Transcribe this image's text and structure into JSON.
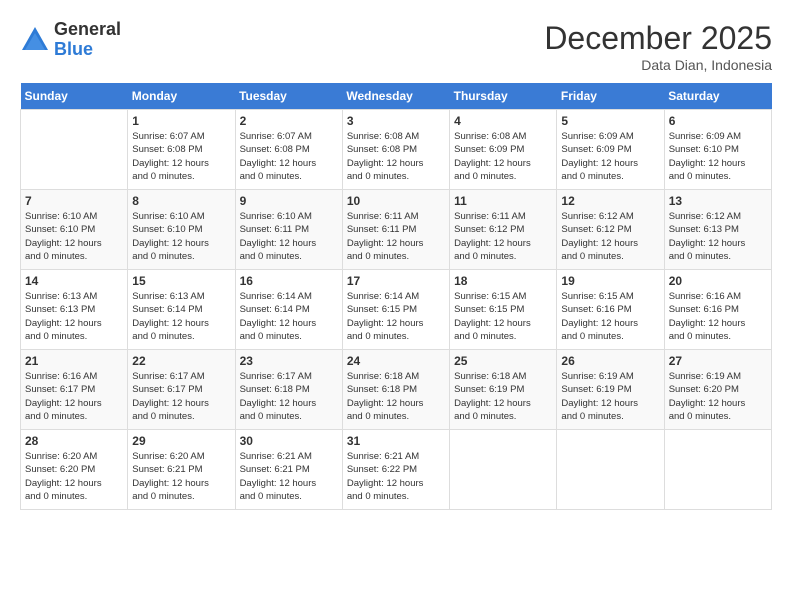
{
  "logo": {
    "general": "General",
    "blue": "Blue"
  },
  "title": "December 2025",
  "subtitle": "Data Dian, Indonesia",
  "days_of_week": [
    "Sunday",
    "Monday",
    "Tuesday",
    "Wednesday",
    "Thursday",
    "Friday",
    "Saturday"
  ],
  "weeks": [
    [
      {
        "day": "",
        "info": ""
      },
      {
        "day": "1",
        "info": "Sunrise: 6:07 AM\nSunset: 6:08 PM\nDaylight: 12 hours\nand 0 minutes."
      },
      {
        "day": "2",
        "info": "Sunrise: 6:07 AM\nSunset: 6:08 PM\nDaylight: 12 hours\nand 0 minutes."
      },
      {
        "day": "3",
        "info": "Sunrise: 6:08 AM\nSunset: 6:08 PM\nDaylight: 12 hours\nand 0 minutes."
      },
      {
        "day": "4",
        "info": "Sunrise: 6:08 AM\nSunset: 6:09 PM\nDaylight: 12 hours\nand 0 minutes."
      },
      {
        "day": "5",
        "info": "Sunrise: 6:09 AM\nSunset: 6:09 PM\nDaylight: 12 hours\nand 0 minutes."
      },
      {
        "day": "6",
        "info": "Sunrise: 6:09 AM\nSunset: 6:10 PM\nDaylight: 12 hours\nand 0 minutes."
      }
    ],
    [
      {
        "day": "7",
        "info": "Sunrise: 6:10 AM\nSunset: 6:10 PM\nDaylight: 12 hours\nand 0 minutes."
      },
      {
        "day": "8",
        "info": "Sunrise: 6:10 AM\nSunset: 6:10 PM\nDaylight: 12 hours\nand 0 minutes."
      },
      {
        "day": "9",
        "info": "Sunrise: 6:10 AM\nSunset: 6:11 PM\nDaylight: 12 hours\nand 0 minutes."
      },
      {
        "day": "10",
        "info": "Sunrise: 6:11 AM\nSunset: 6:11 PM\nDaylight: 12 hours\nand 0 minutes."
      },
      {
        "day": "11",
        "info": "Sunrise: 6:11 AM\nSunset: 6:12 PM\nDaylight: 12 hours\nand 0 minutes."
      },
      {
        "day": "12",
        "info": "Sunrise: 6:12 AM\nSunset: 6:12 PM\nDaylight: 12 hours\nand 0 minutes."
      },
      {
        "day": "13",
        "info": "Sunrise: 6:12 AM\nSunset: 6:13 PM\nDaylight: 12 hours\nand 0 minutes."
      }
    ],
    [
      {
        "day": "14",
        "info": "Sunrise: 6:13 AM\nSunset: 6:13 PM\nDaylight: 12 hours\nand 0 minutes."
      },
      {
        "day": "15",
        "info": "Sunrise: 6:13 AM\nSunset: 6:14 PM\nDaylight: 12 hours\nand 0 minutes."
      },
      {
        "day": "16",
        "info": "Sunrise: 6:14 AM\nSunset: 6:14 PM\nDaylight: 12 hours\nand 0 minutes."
      },
      {
        "day": "17",
        "info": "Sunrise: 6:14 AM\nSunset: 6:15 PM\nDaylight: 12 hours\nand 0 minutes."
      },
      {
        "day": "18",
        "info": "Sunrise: 6:15 AM\nSunset: 6:15 PM\nDaylight: 12 hours\nand 0 minutes."
      },
      {
        "day": "19",
        "info": "Sunrise: 6:15 AM\nSunset: 6:16 PM\nDaylight: 12 hours\nand 0 minutes."
      },
      {
        "day": "20",
        "info": "Sunrise: 6:16 AM\nSunset: 6:16 PM\nDaylight: 12 hours\nand 0 minutes."
      }
    ],
    [
      {
        "day": "21",
        "info": "Sunrise: 6:16 AM\nSunset: 6:17 PM\nDaylight: 12 hours\nand 0 minutes."
      },
      {
        "day": "22",
        "info": "Sunrise: 6:17 AM\nSunset: 6:17 PM\nDaylight: 12 hours\nand 0 minutes."
      },
      {
        "day": "23",
        "info": "Sunrise: 6:17 AM\nSunset: 6:18 PM\nDaylight: 12 hours\nand 0 minutes."
      },
      {
        "day": "24",
        "info": "Sunrise: 6:18 AM\nSunset: 6:18 PM\nDaylight: 12 hours\nand 0 minutes."
      },
      {
        "day": "25",
        "info": "Sunrise: 6:18 AM\nSunset: 6:19 PM\nDaylight: 12 hours\nand 0 minutes."
      },
      {
        "day": "26",
        "info": "Sunrise: 6:19 AM\nSunset: 6:19 PM\nDaylight: 12 hours\nand 0 minutes."
      },
      {
        "day": "27",
        "info": "Sunrise: 6:19 AM\nSunset: 6:20 PM\nDaylight: 12 hours\nand 0 minutes."
      }
    ],
    [
      {
        "day": "28",
        "info": "Sunrise: 6:20 AM\nSunset: 6:20 PM\nDaylight: 12 hours\nand 0 minutes."
      },
      {
        "day": "29",
        "info": "Sunrise: 6:20 AM\nSunset: 6:21 PM\nDaylight: 12 hours\nand 0 minutes."
      },
      {
        "day": "30",
        "info": "Sunrise: 6:21 AM\nSunset: 6:21 PM\nDaylight: 12 hours\nand 0 minutes."
      },
      {
        "day": "31",
        "info": "Sunrise: 6:21 AM\nSunset: 6:22 PM\nDaylight: 12 hours\nand 0 minutes."
      },
      {
        "day": "",
        "info": ""
      },
      {
        "day": "",
        "info": ""
      },
      {
        "day": "",
        "info": ""
      }
    ]
  ]
}
